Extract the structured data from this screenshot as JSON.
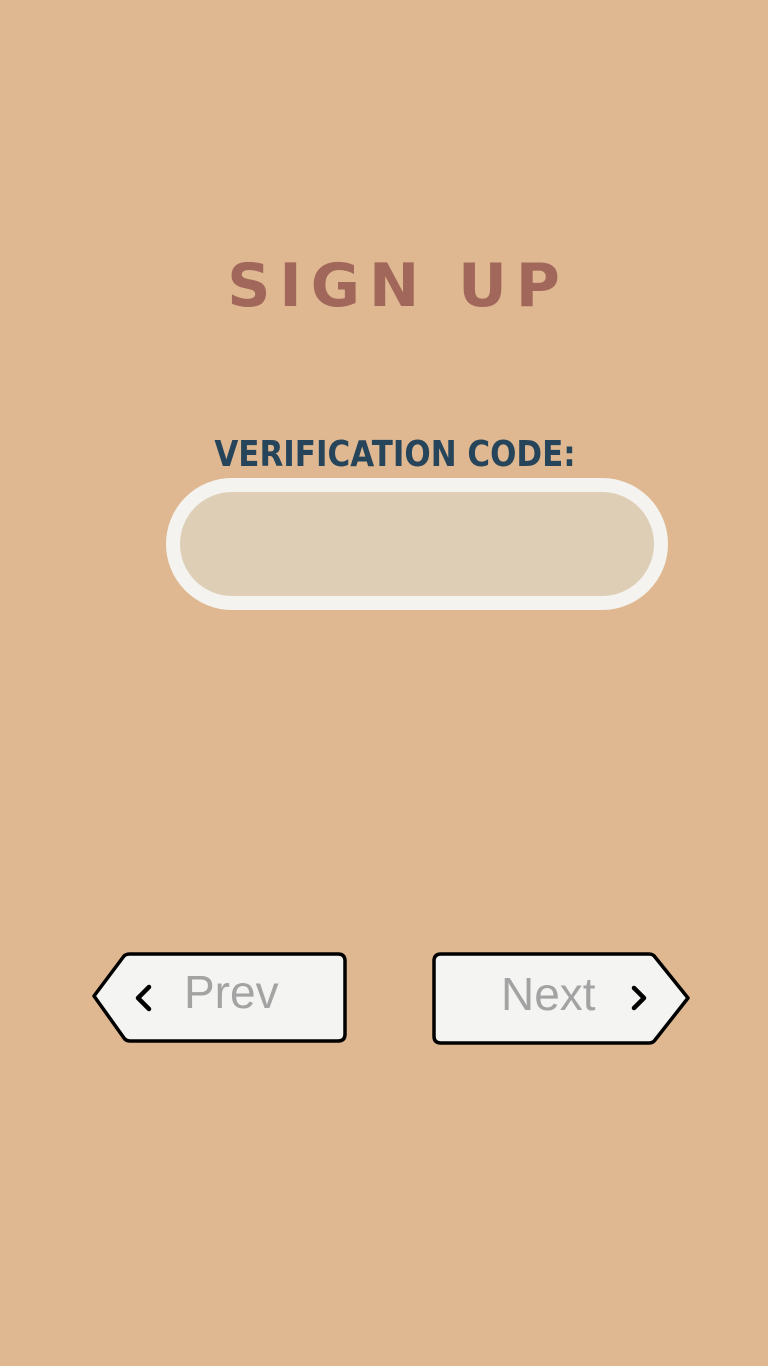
{
  "page": {
    "title": "SIGN UP"
  },
  "form": {
    "code_label": "VERIFICATION CODE:",
    "code_value": "",
    "code_placeholder": ""
  },
  "nav": {
    "prev_label": "Prev",
    "prev_icon": "chevron-left-icon",
    "next_label": "Next",
    "next_icon": "chevron-right-icon"
  },
  "colors": {
    "background": "#dfb891",
    "title": "#a1675b",
    "label": "#26445a",
    "input_fill": "#ddceb5",
    "input_border": "#f4f3ef",
    "button_fill": "#f4f5f2",
    "button_text": "#a3a3a3"
  }
}
